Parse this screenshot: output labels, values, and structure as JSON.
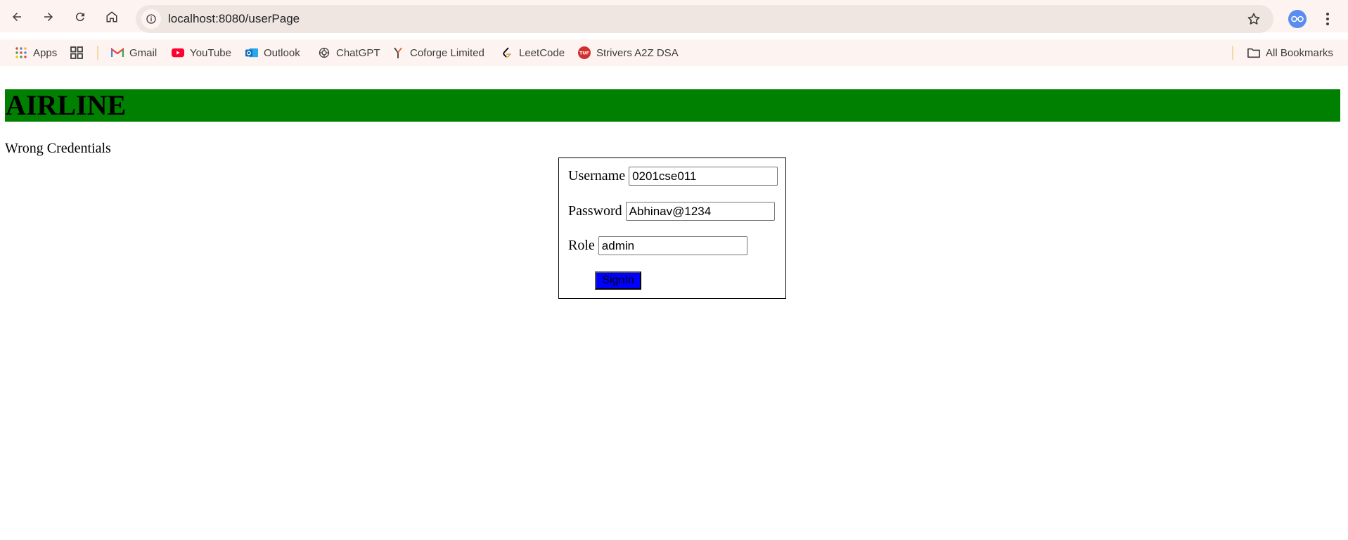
{
  "browser": {
    "url": "localhost:8080/userPage",
    "icons": {
      "back": "arrow-left-icon",
      "forward": "arrow-right-icon",
      "reload": "reload-icon",
      "home": "home-icon",
      "site_info": "info-icon",
      "bookmark_star": "star-icon",
      "menu": "kebab-menu-icon"
    },
    "bookmarks": [
      {
        "label": "Apps",
        "icon": "apps-grid-icon"
      },
      {
        "label": "",
        "icon": "tab-groups-icon"
      },
      {
        "label": "Gmail",
        "icon": "gmail-icon"
      },
      {
        "label": "YouTube",
        "icon": "youtube-icon"
      },
      {
        "label": "Outlook",
        "icon": "outlook-icon"
      },
      {
        "label": "ChatGPT",
        "icon": "chatgpt-icon"
      },
      {
        "label": "Coforge Limited",
        "icon": "coforge-icon"
      },
      {
        "label": "LeetCode",
        "icon": "leetcode-icon"
      },
      {
        "label": "Strivers A2Z DSA",
        "icon": "tuf-icon"
      }
    ],
    "all_bookmarks": "All Bookmarks"
  },
  "page": {
    "title": "AIRLINE",
    "error": "Wrong Credentials",
    "form": {
      "username_label": "Username",
      "username_value": "0201cse011",
      "password_label": "Password",
      "password_value": "Abhinav@1234",
      "role_label": "Role",
      "role_value": "admin",
      "submit_label": "SignIn"
    }
  },
  "colors": {
    "header_bg": "#008000",
    "button_bg": "#0000ff",
    "chrome_bg": "#fdf4f1"
  }
}
